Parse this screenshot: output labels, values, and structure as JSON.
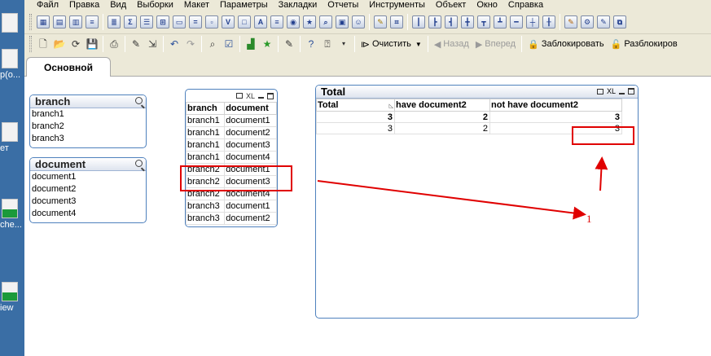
{
  "desktop": {
    "icons": [
      {
        "label": "",
        "color": "white"
      },
      {
        "label": "p(o...",
        "color": "white"
      },
      {
        "label": "ет",
        "color": "white"
      },
      {
        "label": "che...",
        "color": "green"
      },
      {
        "label": "iew",
        "color": "green"
      }
    ]
  },
  "menubar": {
    "items": [
      "Файл",
      "Правка",
      "Вид",
      "Выборки",
      "Макет",
      "Параметры",
      "Закладки",
      "Отчеты",
      "Инструменты",
      "Объект",
      "Окно",
      "Справка"
    ]
  },
  "toolbar1": {
    "icons": [
      "table-icon",
      "pivot-icon",
      "chart-icon",
      "listbox-icon",
      "sigma-icon",
      "multibox-icon",
      "tablebox-icon",
      "button-icon",
      "textobj-icon",
      "lineobj-icon",
      "checkbox-icon",
      "currentsel-icon",
      "inputbox-icon",
      "textbox-icon",
      "slider-icon",
      "calendar-icon",
      "bookmark-icon",
      "search-obj-icon",
      "container-icon",
      "custom-icon",
      "brush-icon",
      "crop-icon",
      "grid-icon",
      "align1-icon",
      "align2-icon",
      "align3-icon",
      "align4-icon",
      "align5-icon",
      "align6-icon"
    ]
  },
  "toolbar2": {
    "clear_label": "Очистить",
    "back_label": "Назад",
    "forward_label": "Вперед",
    "lock_label": "Заблокировать",
    "unlock_label": "Разблокиров"
  },
  "tabs": [
    {
      "label": "Основной"
    }
  ],
  "listbox_branch": {
    "title": "branch",
    "items": [
      "branch1",
      "branch2",
      "branch3"
    ]
  },
  "listbox_document": {
    "title": "document",
    "items": [
      "document1",
      "document2",
      "document3",
      "document4"
    ]
  },
  "tablebox": {
    "caption_xl": "XL",
    "headers": [
      "branch",
      "document"
    ],
    "rows": [
      [
        "branch1",
        "document1"
      ],
      [
        "branch1",
        "document2"
      ],
      [
        "branch1",
        "document3"
      ],
      [
        "branch1",
        "document4"
      ],
      [
        "branch2",
        "document1"
      ],
      [
        "branch2",
        "document3"
      ],
      [
        "branch2",
        "document4"
      ],
      [
        "branch3",
        "document1"
      ],
      [
        "branch3",
        "document2"
      ]
    ]
  },
  "pivot": {
    "title": "Total",
    "caption_xl": "XL",
    "headers": [
      "Total",
      "have document2",
      "not have document2"
    ],
    "total_row": [
      "3",
      "2",
      "3"
    ],
    "rows": [
      [
        "3",
        "2",
        "3"
      ]
    ]
  },
  "annotation": {
    "number_label": "1",
    "color": "#e00000"
  }
}
